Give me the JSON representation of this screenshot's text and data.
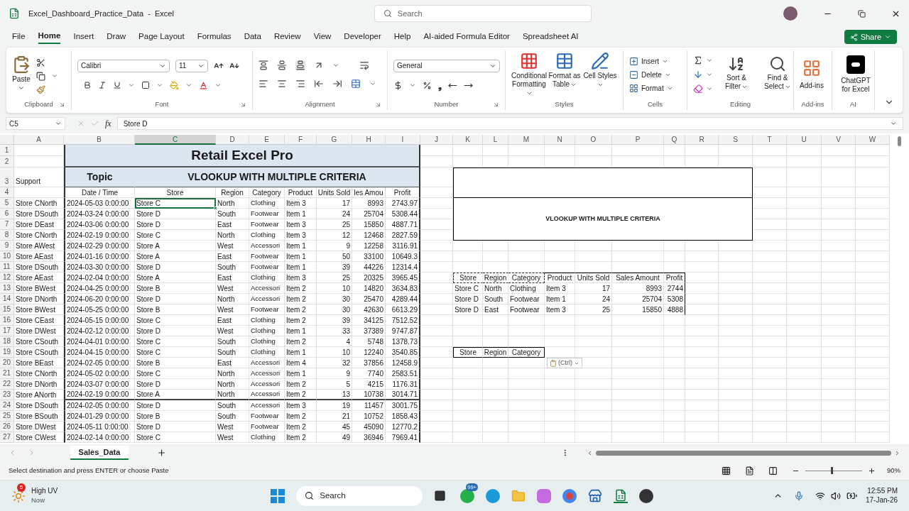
{
  "window": {
    "title": "Excel_Dashboard_Practice_Data  -  Excel",
    "search_placeholder": "Search"
  },
  "menu_tabs": [
    {
      "label": "File",
      "selected": false
    },
    {
      "label": "Home",
      "selected": true
    },
    {
      "label": "Insert",
      "selected": false
    },
    {
      "label": "Draw",
      "selected": false
    },
    {
      "label": "Page Layout",
      "selected": false
    },
    {
      "label": "Formulas",
      "selected": false
    },
    {
      "label": "Data",
      "selected": false
    },
    {
      "label": "Review",
      "selected": false
    },
    {
      "label": "View",
      "selected": false
    },
    {
      "label": "Developer",
      "selected": false
    },
    {
      "label": "Help",
      "selected": false
    },
    {
      "label": "AI-aided Formula Editor",
      "selected": false
    },
    {
      "label": "Spreadsheet AI",
      "selected": false
    }
  ],
  "share": "Share",
  "ribbon": {
    "clipboard": {
      "label": "Clipboard",
      "paste": "Paste"
    },
    "font": {
      "label": "Font",
      "family": "Calibri",
      "size": "11"
    },
    "alignment": {
      "label": "Alignment"
    },
    "number": {
      "label": "Number",
      "format": "General",
      "comma": "❟"
    },
    "styles": {
      "label": "Styles",
      "buttons": [
        "Conditional Formatting",
        "Format as Table",
        "Cell Styles"
      ]
    },
    "cells": {
      "label": "Cells",
      "buttons": [
        "Insert",
        "Delete",
        "Format"
      ]
    },
    "editing": {
      "label": "Editing",
      "buttons": [
        "Sort & Filter",
        "Find & Select"
      ]
    },
    "addins": {
      "label": "Add-ins",
      "button": "Add-ins"
    },
    "ai": {
      "label": "AI",
      "button": "ChatGPT for Excel"
    }
  },
  "formula_bar": {
    "name_box": "C5",
    "fx": "fx",
    "value": "Store D"
  },
  "sheet": {
    "columns": [
      {
        "label": "A",
        "selected": false
      },
      {
        "label": "B",
        "selected": false
      },
      {
        "label": "C",
        "selected": true
      },
      {
        "label": "D",
        "selected": false
      },
      {
        "label": "E",
        "selected": false
      },
      {
        "label": "F",
        "selected": false
      },
      {
        "label": "G",
        "selected": false
      },
      {
        "label": "H",
        "selected": false
      },
      {
        "label": "I",
        "selected": false
      },
      {
        "label": "J",
        "selected": false
      },
      {
        "label": "K",
        "selected": false
      },
      {
        "label": "L",
        "selected": false
      },
      {
        "label": "M",
        "selected": false
      },
      {
        "label": "N",
        "selected": false
      },
      {
        "label": "O",
        "selected": false
      },
      {
        "label": "P",
        "selected": false
      },
      {
        "label": "Q",
        "selected": false
      },
      {
        "label": "R",
        "selected": false
      },
      {
        "label": "S",
        "selected": false
      },
      {
        "label": "T",
        "selected": false
      },
      {
        "label": "U",
        "selected": false
      },
      {
        "label": "V",
        "selected": false
      },
      {
        "label": "W",
        "selected": false
      }
    ],
    "rows": [
      "1",
      "2",
      "3",
      "4",
      "5",
      "6",
      "7",
      "8",
      "9",
      "10",
      "11",
      "12",
      "13",
      "14",
      "15",
      "16",
      "17",
      "18",
      "19",
      "20",
      "21",
      "22",
      "23",
      "24",
      "25",
      "26",
      "27"
    ],
    "title": "Retail Excel Pro",
    "support_label": "Support",
    "topic_label": "Topic",
    "topic": "VLOOKUP WITH MULTIPLE CRITERIA",
    "table": {
      "columns": [
        "Date / Time",
        "Store",
        "Region",
        "Category",
        "Product",
        "Units Sold",
        "les Amou",
        "Profit"
      ],
      "rows": [
        {
          "support": "Store CNorth",
          "selected": true,
          "cells": [
            "2024-05-03 0:00:00",
            "Store C",
            "North",
            "Clothing",
            "Item 3",
            "17",
            "8993",
            "2743.97"
          ]
        },
        {
          "support": "Store DSouth",
          "selected": false,
          "cells": [
            "2024-03-24 0:00:00",
            "Store D",
            "South",
            "Footwear",
            "Item 1",
            "24",
            "25704",
            "5308.44"
          ]
        },
        {
          "support": "Store DEast",
          "selected": false,
          "cells": [
            "2024-03-06 0:00:00",
            "Store D",
            "East",
            "Footwear",
            "Item 3",
            "25",
            "15850",
            "4887.71"
          ]
        },
        {
          "support": "Store CNorth",
          "selected": false,
          "cells": [
            "2024-02-19 0:00:00",
            "Store C",
            "North",
            "Clothing",
            "Item 3",
            "12",
            "12468",
            "2827.59"
          ]
        },
        {
          "support": "Store AWest",
          "selected": false,
          "cells": [
            "2024-02-29 0:00:00",
            "Store A",
            "West",
            "Accessori",
            "Item 1",
            "9",
            "12258",
            "3116.91"
          ]
        },
        {
          "support": "Store AEast",
          "selected": false,
          "cells": [
            "2024-01-16 0:00:00",
            "Store A",
            "East",
            "Footwear",
            "Item 1",
            "50",
            "33100",
            "10649.3"
          ]
        },
        {
          "support": "Store DSouth",
          "selected": false,
          "cells": [
            "2024-03-30 0:00:00",
            "Store D",
            "South",
            "Footwear",
            "Item 1",
            "39",
            "44226",
            "12314.4"
          ]
        },
        {
          "support": "Store AEast",
          "selected": false,
          "cells": [
            "2024-02-04 0:00:00",
            "Store A",
            "East",
            "Clothing",
            "Item 3",
            "25",
            "20325",
            "3965.45"
          ]
        },
        {
          "support": "Store BWest",
          "selected": false,
          "cells": [
            "2024-04-25 0:00:00",
            "Store B",
            "West",
            "Accessori",
            "Item 2",
            "10",
            "14820",
            "3634.83"
          ]
        },
        {
          "support": "Store DNorth",
          "selected": false,
          "cells": [
            "2024-06-20 0:00:00",
            "Store D",
            "North",
            "Accessori",
            "Item 2",
            "30",
            "25470",
            "4289.44"
          ]
        },
        {
          "support": "Store BWest",
          "selected": false,
          "cells": [
            "2024-05-25 0:00:00",
            "Store B",
            "West",
            "Footwear",
            "Item 2",
            "30",
            "42630",
            "6613.29"
          ]
        },
        {
          "support": "Store CEast",
          "selected": false,
          "cells": [
            "2024-05-15 0:00:00",
            "Store C",
            "East",
            "Clothing",
            "Item 2",
            "39",
            "34125",
            "7512.52"
          ]
        },
        {
          "support": "Store DWest",
          "selected": false,
          "cells": [
            "2024-02-12 0:00:00",
            "Store D",
            "West",
            "Clothing",
            "Item 1",
            "33",
            "37389",
            "9747.87"
          ]
        },
        {
          "support": "Store CSouth",
          "selected": false,
          "cells": [
            "2024-04-01 0:00:00",
            "Store C",
            "South",
            "Clothing",
            "Item 2",
            "4",
            "5748",
            "1378.73"
          ]
        },
        {
          "support": "Store CSouth",
          "selected": false,
          "cells": [
            "2024-04-15 0:00:00",
            "Store C",
            "South",
            "Clothing",
            "Item 1",
            "10",
            "12240",
            "3540.85"
          ]
        },
        {
          "support": "Store BEast",
          "selected": false,
          "cells": [
            "2024-02-05 0:00:00",
            "Store B",
            "East",
            "Accessori",
            "Item 4",
            "32",
            "37856",
            "12458.9"
          ]
        },
        {
          "support": "Store CNorth",
          "selected": false,
          "cells": [
            "2024-05-02 0:00:00",
            "Store C",
            "North",
            "Accessori",
            "Item 1",
            "9",
            "7740",
            "2583.51"
          ]
        },
        {
          "support": "Store DNorth",
          "selected": false,
          "cells": [
            "2024-03-07 0:00:00",
            "Store D",
            "North",
            "Accessori",
            "Item 2",
            "5",
            "4215",
            "1176.31"
          ]
        },
        {
          "support": "Store ANorth",
          "selected": false,
          "cells": [
            "2024-02-19 0:00:00",
            "Store A",
            "North",
            "Accessori",
            "Item 2",
            "13",
            "10738",
            "3014.71"
          ]
        },
        {
          "support": "Store DSouth",
          "selected": false,
          "cells": [
            "2024-02-05 0:00:00",
            "Store D",
            "South",
            "Accessori",
            "Item 3",
            "19",
            "11457",
            "3001.75"
          ]
        },
        {
          "support": "Store BSouth",
          "selected": false,
          "cells": [
            "2024-01-29 0:00:00",
            "Store B",
            "South",
            "Footwear",
            "Item 2",
            "21",
            "10752",
            "1858.43"
          ]
        },
        {
          "support": "Store DWest",
          "selected": false,
          "cells": [
            "2024-05-11 0:00:00",
            "Store D",
            "West",
            "Footwear",
            "Item 2",
            "45",
            "45090",
            "12770.2"
          ]
        },
        {
          "support": "Store CWest",
          "selected": false,
          "cells": [
            "2024-02-14 0:00:00",
            "Store C",
            "West",
            "Clothing",
            "Item 2",
            "49",
            "36946",
            "7969.41"
          ]
        }
      ]
    },
    "panel_title": "VLOOKUP WITH MULTIPLE CRITERIA",
    "lookup": {
      "columns": [
        {
          "label": "Store",
          "copied": true
        },
        {
          "label": "Region",
          "copied": true
        },
        {
          "label": "Category",
          "copied": true
        },
        {
          "label": "Product",
          "copied": false
        },
        {
          "label": "Units Sold",
          "copied": false
        },
        {
          "label": "Sales Amount",
          "copied": false
        },
        {
          "label": "Profit",
          "copied": false
        }
      ],
      "rows": [
        [
          "Store C",
          "North",
          "Clothing",
          "Item 3",
          "17",
          "8993",
          "2744"
        ],
        [
          "Store D",
          "South",
          "Footwear",
          "Item 1",
          "24",
          "25704",
          "5308"
        ],
        [
          "Store D",
          "East",
          "Footwear",
          "Item 3",
          "25",
          "15850",
          "4888"
        ]
      ]
    },
    "criteria_header": [
      "Store",
      "Region",
      "Category"
    ],
    "paste_options": "(Ctrl)"
  },
  "sheet_tabs": [
    {
      "label": "Sales_Data",
      "selected": true
    }
  ],
  "status_bar": {
    "message": "Select destination and press ENTER or choose Paste",
    "zoom": "90%",
    "zoom_slider": {
      "level": 0.45
    }
  },
  "taskbar": {
    "weather_badge": "5",
    "weather_title": "High UV",
    "weather_subtitle": "Now",
    "search": "Search",
    "chat_badge": "99+",
    "time": "12:55 PM",
    "date": "17-Jan-26"
  }
}
